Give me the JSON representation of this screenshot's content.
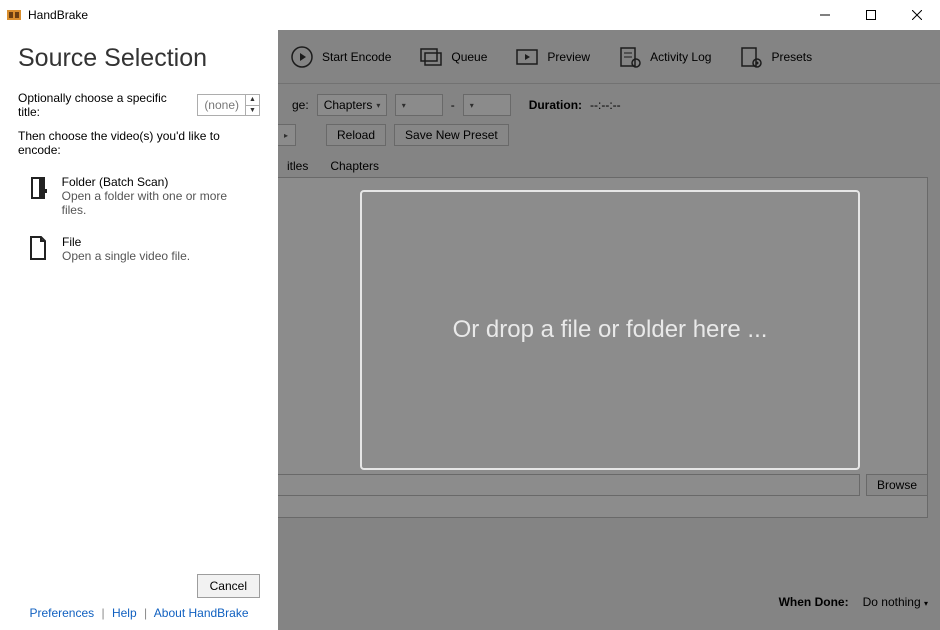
{
  "titlebar": {
    "title": "HandBrake"
  },
  "toolbar": {
    "start_encode": "Start Encode",
    "queue": "Queue",
    "preview": "Preview",
    "activity_log": "Activity Log",
    "presets": "Presets"
  },
  "main": {
    "range_label": "ge:",
    "range_type": "Chapters",
    "range_sep": "-",
    "duration_label": "Duration:",
    "duration_value": "--:--:--",
    "reload_btn": "Reload",
    "save_preset_btn": "Save New Preset",
    "tabs": {
      "subtitles": "itles",
      "chapters": "Chapters"
    },
    "browse_btn": "Browse",
    "when_done_label": "When Done:",
    "when_done_value": "Do nothing"
  },
  "dropzone_text": "Or drop a file or folder here ...",
  "source_panel": {
    "heading": "Source Selection",
    "title_row_label": "Optionally choose a specific title:",
    "title_spinner_value": "(none)",
    "instruction": "Then choose the video(s) you'd like to encode:",
    "folder_option": {
      "title": "Folder (Batch Scan)",
      "desc": "Open a folder with one or more files."
    },
    "file_option": {
      "title": "File",
      "desc": "Open a single video file."
    },
    "cancel_btn": "Cancel",
    "links": {
      "preferences": "Preferences",
      "help": "Help",
      "about": "About HandBrake"
    }
  }
}
